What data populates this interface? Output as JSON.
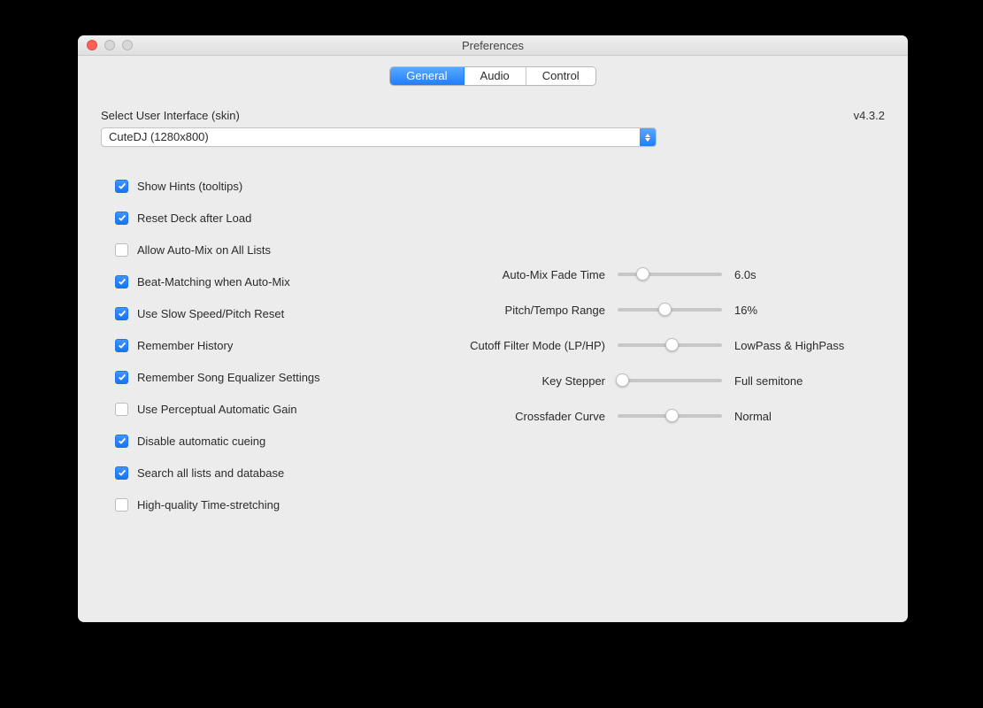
{
  "window": {
    "title": "Preferences",
    "version": "v4.3.2"
  },
  "tabs": [
    {
      "label": "General",
      "active": true
    },
    {
      "label": "Audio",
      "active": false
    },
    {
      "label": "Control",
      "active": false
    }
  ],
  "skin": {
    "label": "Select User Interface (skin)",
    "selected": "CuteDJ (1280x800)"
  },
  "checkboxes": [
    {
      "label": "Show Hints (tooltips)",
      "checked": true
    },
    {
      "label": "Reset Deck after Load",
      "checked": true
    },
    {
      "label": "Allow Auto-Mix on All Lists",
      "checked": false
    },
    {
      "label": "Beat-Matching when Auto-Mix",
      "checked": true
    },
    {
      "label": "Use Slow Speed/Pitch Reset",
      "checked": true
    },
    {
      "label": "Remember History",
      "checked": true
    },
    {
      "label": "Remember Song Equalizer Settings",
      "checked": true
    },
    {
      "label": "Use Perceptual Automatic Gain",
      "checked": false
    },
    {
      "label": "Disable automatic cueing",
      "checked": true
    },
    {
      "label": "Search all lists and database",
      "checked": true
    },
    {
      "label": "High-quality Time-stretching",
      "checked": false
    }
  ],
  "sliders": [
    {
      "label": "Auto-Mix Fade Time",
      "value": "6.0s",
      "pos": 24
    },
    {
      "label": "Pitch/Tempo Range",
      "value": "16%",
      "pos": 45
    },
    {
      "label": "Cutoff Filter Mode (LP/HP)",
      "value": "LowPass & HighPass",
      "pos": 52
    },
    {
      "label": "Key Stepper",
      "value": "Full semitone",
      "pos": 4
    },
    {
      "label": "Crossfader Curve",
      "value": "Normal",
      "pos": 52
    }
  ]
}
